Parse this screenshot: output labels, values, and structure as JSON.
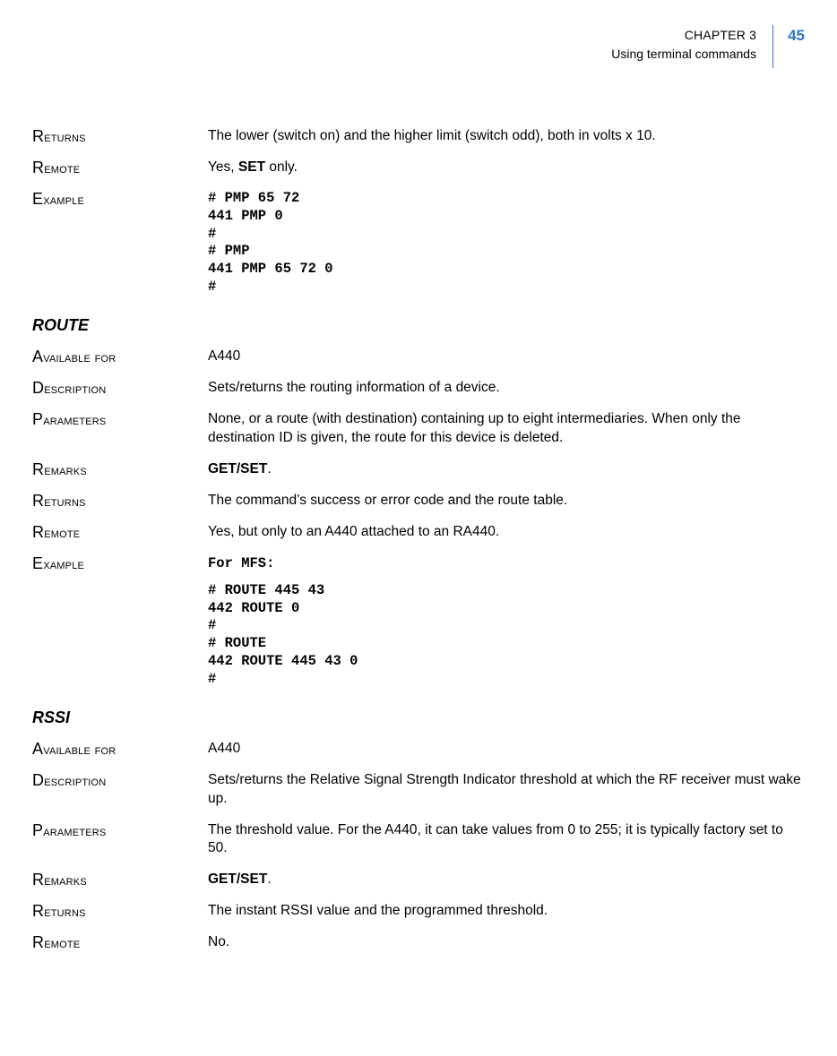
{
  "header": {
    "chapter": "CHAPTER 3",
    "subtitle": "Using terminal commands",
    "page_number": "45"
  },
  "sections": [
    {
      "rows": [
        {
          "label": "Returns",
          "value": "The lower (switch on) and the higher limit (switch odd), both in volts x 10."
        },
        {
          "label": "Remote",
          "value_pre": "Yes, ",
          "value_strong": "SET",
          "value_post": " only."
        },
        {
          "label": "Example",
          "code": "# PMP 65 72\n441 PMP 0\n#\n# PMP\n441 PMP 65 72 0\n#"
        }
      ]
    },
    {
      "heading": "ROUTE",
      "rows": [
        {
          "label": "Available for",
          "value": "A440"
        },
        {
          "label": "Description",
          "value": "Sets/returns the routing information of a device."
        },
        {
          "label": "Parameters",
          "value": "None, or a route (with destination) containing up to eight intermediaries. When only the destination ID is given, the route for this device is deleted."
        },
        {
          "label": "Remarks",
          "value_strong": "GET/SET",
          "value_post": "."
        },
        {
          "label": "Returns",
          "value": "The command’s success or error code and the route table."
        },
        {
          "label": "Remote",
          "value": "Yes, but only to an A440 attached to an RA440."
        },
        {
          "label": "Example",
          "code_title": "For MFS:",
          "code": "# ROUTE 445 43\n442 ROUTE 0\n#\n# ROUTE\n442 ROUTE 445 43 0\n#"
        }
      ]
    },
    {
      "heading": "RSSI",
      "rows": [
        {
          "label": "Available for",
          "value": "A440"
        },
        {
          "label": "Description",
          "value": "Sets/returns the Relative Signal Strength Indicator threshold at which the RF receiver must wake up."
        },
        {
          "label": "Parameters",
          "value": "The threshold value. For the A440, it can take values from 0 to 255; it is typically factory set to 50."
        },
        {
          "label": "Remarks",
          "value_strong": "GET/SET",
          "value_post": "."
        },
        {
          "label": "Returns",
          "value": "The instant RSSI value and the programmed threshold."
        },
        {
          "label": "Remote",
          "value": "No."
        }
      ]
    }
  ]
}
